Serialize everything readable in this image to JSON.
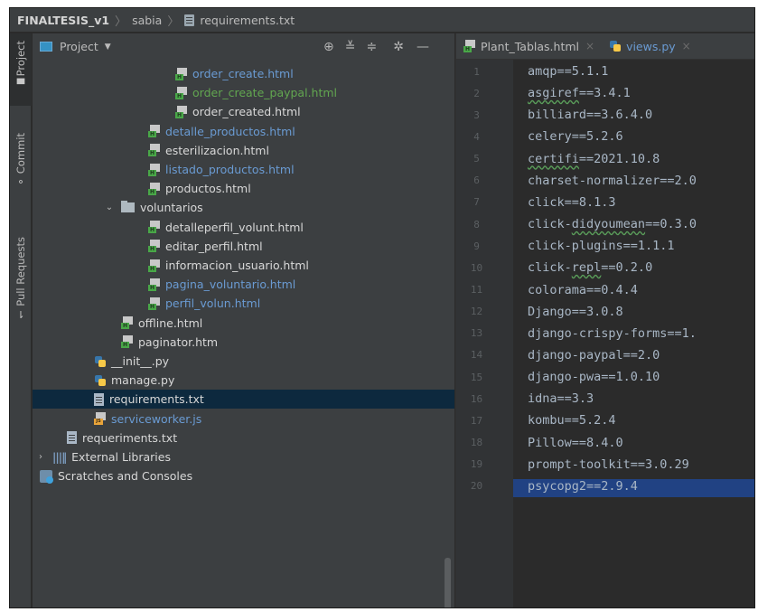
{
  "breadcrumb": [
    "FINALTESIS_v1",
    "sabia",
    "requirements.txt"
  ],
  "tool_strip": [
    "Project",
    "Commit",
    "Pull Requests"
  ],
  "project_panel": {
    "title": "Project",
    "tree": [
      {
        "label": "order_create.html",
        "kind": "html",
        "color": "blue",
        "depth": 5
      },
      {
        "label": "order_create_paypal.html",
        "kind": "html",
        "color": "green",
        "depth": 5
      },
      {
        "label": "order_created.html",
        "kind": "html",
        "color": "white",
        "depth": 5
      },
      {
        "label": "detalle_productos.html",
        "kind": "html",
        "color": "blue",
        "depth": 4
      },
      {
        "label": "esterilizacion.html",
        "kind": "html",
        "color": "white",
        "depth": 4
      },
      {
        "label": "listado_productos.html",
        "kind": "html",
        "color": "blue",
        "depth": 4
      },
      {
        "label": "productos.html",
        "kind": "html",
        "color": "white",
        "depth": 4
      },
      {
        "label": "voluntarios",
        "kind": "folder",
        "color": "white",
        "depth": 3,
        "expanded": true
      },
      {
        "label": "detalleperfil_volunt.html",
        "kind": "html",
        "color": "white",
        "depth": 4
      },
      {
        "label": "editar_perfil.html",
        "kind": "html",
        "color": "white",
        "depth": 4
      },
      {
        "label": "informacion_usuario.html",
        "kind": "html",
        "color": "white",
        "depth": 4
      },
      {
        "label": "pagina_voluntario.html",
        "kind": "html",
        "color": "blue",
        "depth": 4
      },
      {
        "label": "perfil_volun.html",
        "kind": "html",
        "color": "blue",
        "depth": 4
      },
      {
        "label": "offline.html",
        "kind": "html",
        "color": "white",
        "depth": 3
      },
      {
        "label": "paginator.htm",
        "kind": "html",
        "color": "white",
        "depth": 3
      },
      {
        "label": "__init__.py",
        "kind": "py",
        "color": "white",
        "depth": 2
      },
      {
        "label": "manage.py",
        "kind": "py",
        "color": "white",
        "depth": 2
      },
      {
        "label": "requirements.txt",
        "kind": "txt",
        "color": "white",
        "depth": 2,
        "selected": true
      },
      {
        "label": "serviceworker.js",
        "kind": "js",
        "color": "blue",
        "depth": 2
      },
      {
        "label": "requeriments.txt",
        "kind": "txt",
        "color": "white",
        "depth": 1
      },
      {
        "label": "External Libraries",
        "kind": "lib",
        "color": "white",
        "depth": 0,
        "expanded": false
      },
      {
        "label": "Scratches and Consoles",
        "kind": "scratch",
        "color": "white",
        "depth": 0
      }
    ]
  },
  "editor": {
    "tabs": [
      {
        "label": "Plant_Tablas.html",
        "kind": "html"
      },
      {
        "label": "views.py",
        "kind": "py"
      }
    ],
    "lines": [
      {
        "n": "1",
        "text": "amqp==5.1.1"
      },
      {
        "n": "2",
        "text": "asgiref==3.4.1",
        "underline": "asgiref"
      },
      {
        "n": "3",
        "text": "billiard==3.6.4.0"
      },
      {
        "n": "4",
        "text": "celery==5.2.6"
      },
      {
        "n": "5",
        "text": "certifi==2021.10.8",
        "underline": "certifi"
      },
      {
        "n": "6",
        "text": "charset-normalizer==2.0"
      },
      {
        "n": "7",
        "text": "click==8.1.3"
      },
      {
        "n": "8",
        "text": "click-didyoumean==0.3.0",
        "underline": "didyoumean"
      },
      {
        "n": "9",
        "text": "click-plugins==1.1.1"
      },
      {
        "n": "10",
        "text": "click-repl==0.2.0",
        "underline": "repl"
      },
      {
        "n": "11",
        "text": "colorama==0.4.4"
      },
      {
        "n": "12",
        "text": "Django==3.0.8"
      },
      {
        "n": "13",
        "text": "django-crispy-forms==1."
      },
      {
        "n": "14",
        "text": "django-paypal==2.0"
      },
      {
        "n": "15",
        "text": "django-pwa==1.0.10"
      },
      {
        "n": "16",
        "text": "idna==3.3"
      },
      {
        "n": "17",
        "text": "kombu==5.2.4"
      },
      {
        "n": "18",
        "text": "Pillow==8.4.0"
      },
      {
        "n": "19",
        "text": "prompt-toolkit==3.0.29"
      },
      {
        "n": "20",
        "text": "psycopg2==2.9.4",
        "highlight": true
      }
    ]
  }
}
